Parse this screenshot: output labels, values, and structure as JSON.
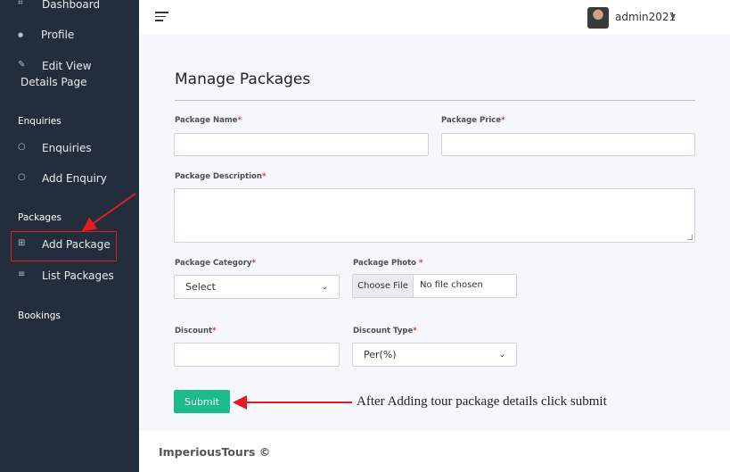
{
  "sidebar": {
    "items": [
      {
        "label": "Dashboard",
        "icon": "dashboard-icon",
        "glyph": "⌗"
      },
      {
        "label": "Profile",
        "icon": "user-icon",
        "glyph": "●"
      },
      {
        "label_line1": "Edit View",
        "label_line2": "Details Page",
        "icon": "edit-icon",
        "glyph": "✎"
      }
    ],
    "enquiries_header": "Enquiries",
    "enquiries_items": [
      {
        "label": "Enquiries",
        "icon": "chat-icon",
        "glyph": "○"
      },
      {
        "label": "Add Enquiry",
        "icon": "chat-icon",
        "glyph": "○"
      }
    ],
    "packages_header": "Packages",
    "packages_items": [
      {
        "label": "Add Package",
        "icon": "plus-square-icon",
        "glyph": "⊞"
      },
      {
        "label": "List Packages",
        "icon": "list-icon",
        "glyph": "≡"
      }
    ],
    "bookings_header": "Bookings"
  },
  "topbar": {
    "user": "admin2021"
  },
  "form": {
    "title": "Manage Packages",
    "required_mark": "*",
    "package_name_label": "Package Name",
    "package_name_value": "",
    "package_price_label": "Package Price",
    "package_price_value": "",
    "package_description_label": "Package Description",
    "package_description_value": "",
    "package_category_label": "Package Category",
    "package_category_selected": "Select",
    "package_photo_label": "Package Photo ",
    "choose_file_label": "Choose File",
    "no_file_text": "No file chosen",
    "discount_label": "Discount",
    "discount_value": "",
    "discount_type_label": "Discount Type",
    "discount_type_selected": "Per(%)",
    "submit_label": "Submit"
  },
  "annotation": "After Adding tour package details click submit",
  "footer": {
    "text": "ImperiousTours ©"
  },
  "colors": {
    "sidebar_bg": "#222e3c",
    "submit_bg": "#1cbb8c",
    "required": "#e3342f",
    "annotation_arrow": "#e31b23"
  }
}
